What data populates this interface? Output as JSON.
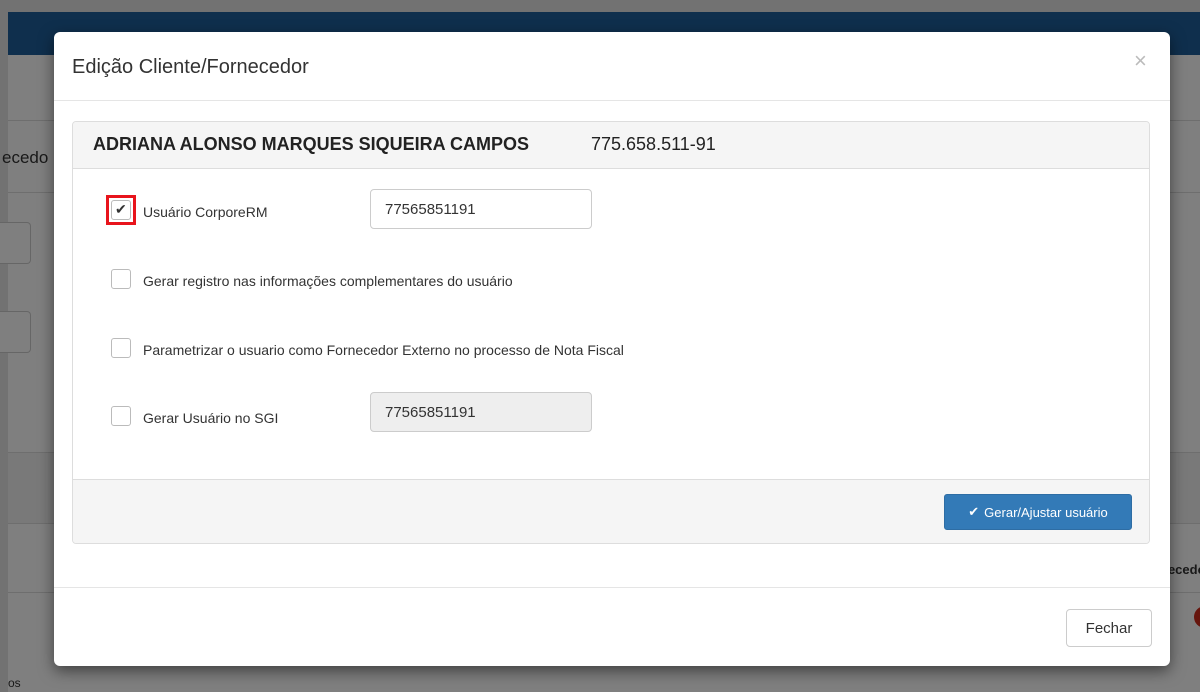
{
  "background": {
    "topbar_color": "#1f5f9a",
    "left_text": "ecedo",
    "right_text": "necedo",
    "bottom_text": "os"
  },
  "modal": {
    "title": "Edição Cliente/Fornecedor",
    "close_label": "×",
    "panel": {
      "name": "ADRIANA ALONSO MARQUES SIQUEIRA CAMPOS",
      "document": "775.658.511-91",
      "options": [
        {
          "label": "Usuário CorporeRM",
          "checked": true,
          "value": "77565851191"
        },
        {
          "label": "Gerar registro nas informações complementares do usuário",
          "checked": false
        },
        {
          "label": "Parametrizar o usuario como Fornecedor Externo no processo de Nota Fiscal",
          "checked": false
        },
        {
          "label": "Gerar Usuário no SGI",
          "checked": false,
          "value": "77565851191",
          "disabled": true
        }
      ],
      "submit_label": "Gerar/Ajustar usuário",
      "submit_color": "#337ab7"
    },
    "close_button_label": "Fechar"
  }
}
